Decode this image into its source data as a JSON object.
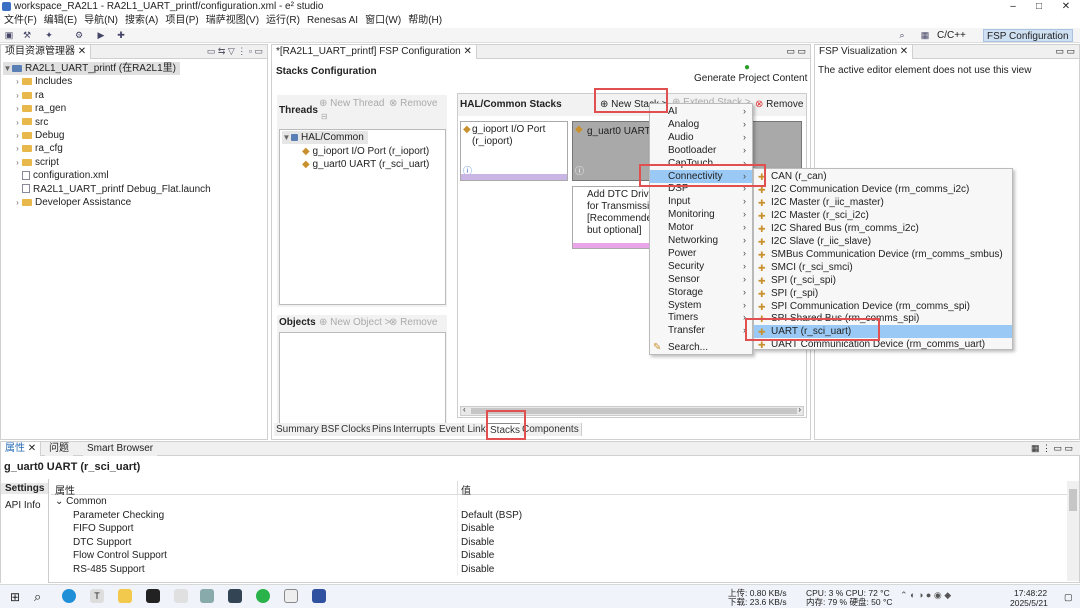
{
  "window": {
    "title": "workspace_RA2L1 - RA2L1_UART_printf/configuration.xml - e² studio",
    "minimize": "–",
    "maximize": "□",
    "close": "✕"
  },
  "menu": [
    "文件(F)",
    "编辑(E)",
    "导航(N)",
    "搜索(A)",
    "项目(P)",
    "瑞萨视图(V)",
    "运行(R)",
    "Renesas AI",
    "窗口(W)",
    "帮助(H)"
  ],
  "perspectives": {
    "cpp": "C/C++",
    "fsp": "FSP Configuration"
  },
  "explorer": {
    "tab": "项目资源管理器",
    "items": [
      {
        "label": "RA2L1_UART_printf (在RA2L1里)",
        "indent": 0,
        "kind": "project"
      },
      {
        "label": "Includes",
        "indent": 1,
        "kind": "folder"
      },
      {
        "label": "ra",
        "indent": 1,
        "kind": "folder"
      },
      {
        "label": "ra_gen",
        "indent": 1,
        "kind": "folder"
      },
      {
        "label": "src",
        "indent": 1,
        "kind": "folder"
      },
      {
        "label": "Debug",
        "indent": 1,
        "kind": "folder"
      },
      {
        "label": "ra_cfg",
        "indent": 1,
        "kind": "folder"
      },
      {
        "label": "script",
        "indent": 1,
        "kind": "folder"
      },
      {
        "label": "configuration.xml",
        "indent": 1,
        "kind": "file"
      },
      {
        "label": "RA2L1_UART_printf Debug_Flat.launch",
        "indent": 1,
        "kind": "file"
      },
      {
        "label": "Developer Assistance",
        "indent": 1,
        "kind": "folder"
      }
    ]
  },
  "editor": {
    "tab": "*[RA2L1_UART_printf] FSP Configuration",
    "heading": "Stacks Configuration",
    "generate": "Generate Project Content",
    "threads": {
      "title": "Threads",
      "new": "New Thread",
      "remove": "Remove",
      "items": [
        "HAL/Common",
        "g_ioport I/O Port (r_ioport)",
        "g_uart0 UART (r_sci_uart)"
      ]
    },
    "objects": {
      "title": "Objects",
      "new": "New Object >",
      "remove": "Remove"
    },
    "stacks": {
      "title": "HAL/Common Stacks",
      "new_stack": "New Stack >",
      "extend": "Extend Stack >",
      "remove": "Remove",
      "block1": "g_ioport I/O Port (r_ioport)",
      "block2": "g_uart0 UART",
      "block3": "Add DTC Driver for Transmission [Recommended but optional]"
    },
    "bottom_tabs": [
      "Summary",
      "BSP",
      "Clocks",
      "Pins",
      "Interrupts",
      "Event Links",
      "Stacks",
      "Components"
    ]
  },
  "viz": {
    "tab": "FSP Visualization",
    "msg": "The active editor element does not use this view"
  },
  "new_stack_menu": [
    "AI",
    "Analog",
    "Audio",
    "Bootloader",
    "CapTouch",
    "Connectivity",
    "DSP",
    "Input",
    "Monitoring",
    "Motor",
    "Networking",
    "Power",
    "Security",
    "Sensor",
    "Storage",
    "System",
    "Timers",
    "Transfer",
    "Search..."
  ],
  "connectivity_menu": [
    "CAN (r_can)",
    "I2C Communication Device (rm_comms_i2c)",
    "I2C Master (r_iic_master)",
    "I2C Master (r_sci_i2c)",
    "I2C Shared Bus (rm_comms_i2c)",
    "I2C Slave (r_iic_slave)",
    "SMBus Communication Device (rm_comms_smbus)",
    "SMCI (r_sci_smci)",
    "SPI (r_sci_spi)",
    "SPI (r_spi)",
    "SPI Communication Device (rm_comms_spi)",
    "SPI Shared Bus (rm_comms_spi)",
    "UART (r_sci_uart)",
    "UART Communication Device (rm_comms_uart)"
  ],
  "properties": {
    "tabs": [
      "属性",
      "问题",
      "Smart Browser"
    ],
    "title": "g_uart0 UART (r_sci_uart)",
    "side": [
      "Settings",
      "API Info"
    ],
    "col_prop": "属性",
    "col_val": "值",
    "rows": [
      {
        "name": "Common",
        "value": "",
        "group": true
      },
      {
        "name": "Parameter Checking",
        "value": "Default (BSP)"
      },
      {
        "name": "FIFO Support",
        "value": "Disable"
      },
      {
        "name": "DTC Support",
        "value": "Disable"
      },
      {
        "name": "Flow Control Support",
        "value": "Disable"
      },
      {
        "name": "RS-485 Support",
        "value": "Disable"
      }
    ]
  },
  "taskbar": {
    "up": "上传:  0.80 KB/s",
    "down": "下载:  23.6 KB/s",
    "cpu": "CPU: 3 %  CPU: 72 °C",
    "mem": "内存: 79 % 硬盘: 50 °C",
    "time": "17:48:22",
    "date": "2025/5/21"
  }
}
